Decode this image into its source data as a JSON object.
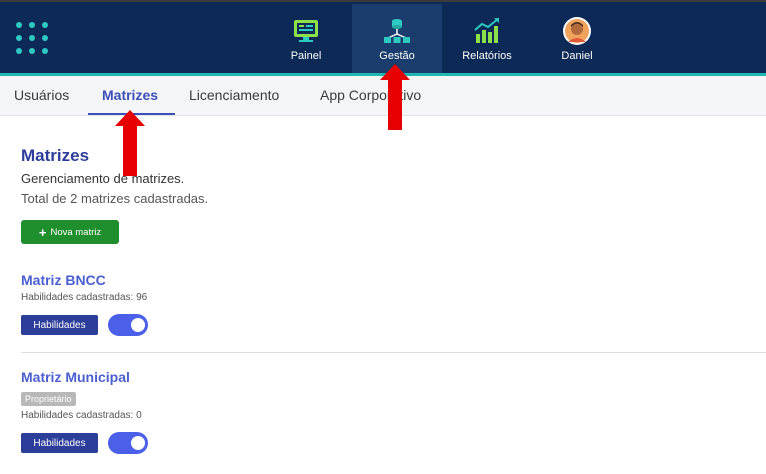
{
  "topnav": {
    "items": [
      {
        "label": "Painel",
        "icon": "dashboard-monitor-icon"
      },
      {
        "label": "Gestão",
        "icon": "management-network-icon",
        "active": true
      },
      {
        "label": "Relatórios",
        "icon": "reports-chart-icon"
      },
      {
        "label": "Daniel",
        "icon": "user-avatar"
      }
    ]
  },
  "subnav": {
    "tabs": [
      {
        "label": "Usuários"
      },
      {
        "label": "Matrizes",
        "active": true
      },
      {
        "label": "Licenciamento"
      },
      {
        "label": "App Corporativo"
      }
    ]
  },
  "main": {
    "title": "Matrizes",
    "subtitle": "Gerenciamento de matrizes.",
    "total": "Total de 2 matrizes cadastradas.",
    "new_button": "Nova matriz"
  },
  "matrices": [
    {
      "name": "Matriz BNCC",
      "meta": "Habilidades cadastradas: 96",
      "badge": "",
      "button": "Habilidades",
      "enabled": true
    },
    {
      "name": "Matriz Municipal",
      "meta": "Habilidades cadastradas: 0",
      "badge": "Proprietário",
      "button": "Habilidades",
      "enabled": true
    }
  ],
  "colors": {
    "header_bg": "#0d2a57",
    "accent_teal": "#1fb7b0",
    "primary_blue": "#2c3d9a",
    "link_blue": "#4b5fd1",
    "success_green": "#1f8f2e",
    "arrow_red": "#e60000"
  }
}
